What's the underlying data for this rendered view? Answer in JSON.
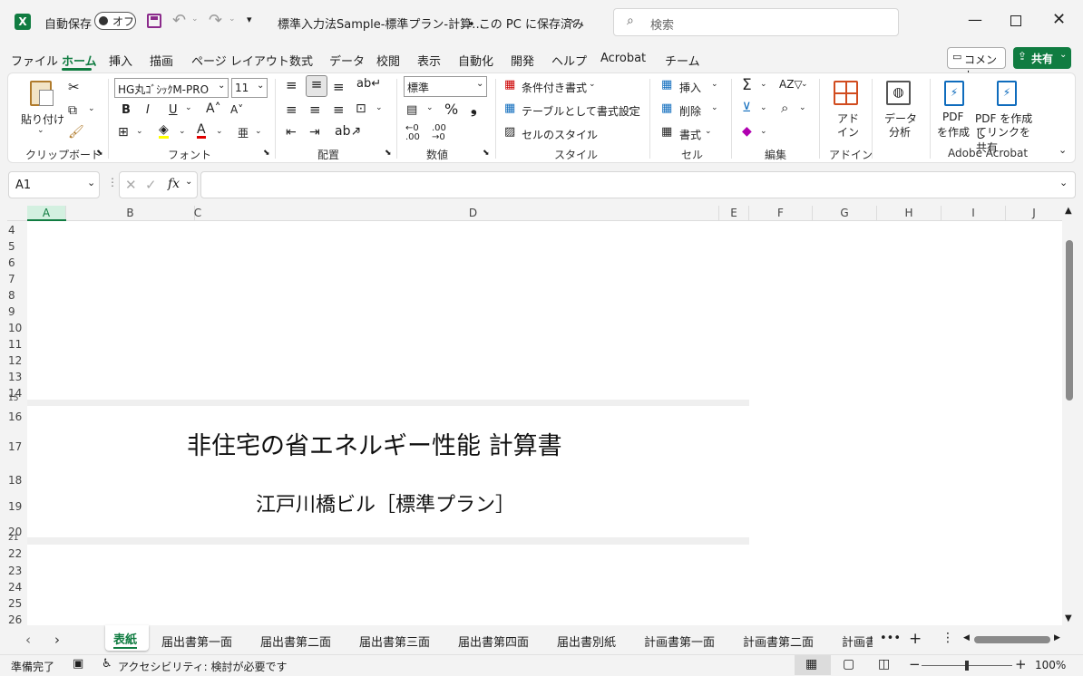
{
  "title_bar": {
    "autosave_label": "自動保存",
    "autosave_state": "オフ",
    "document_title": "標準入力法Sample-標準プラン-計算…",
    "save_status": "• この PC に保存済み",
    "search_placeholder": "検索"
  },
  "menu_tabs": [
    "ファイル",
    "ホーム",
    "挿入",
    "描画",
    "ページ レイアウト",
    "数式",
    "データ",
    "校閲",
    "表示",
    "自動化",
    "開発",
    "ヘルプ",
    "Acrobat",
    "チーム"
  ],
  "active_tab": "ホーム",
  "comment_button": "コメント",
  "share_button": "共有",
  "ribbon": {
    "clipboard": {
      "paste": "貼り付け",
      "group": "クリップボード"
    },
    "font": {
      "name": "HG丸ｺﾞｼｯｸM-PRO",
      "size": "11",
      "bold": "B",
      "italic": "I",
      "underline": "U",
      "group": "フォント"
    },
    "alignment": {
      "group": "配置"
    },
    "number": {
      "format": "標準",
      "percent": "%",
      "group": "数値"
    },
    "styles": {
      "conditional": "条件付き書式",
      "table": "テーブルとして書式設定",
      "cell_styles": "セルのスタイル",
      "group": "スタイル"
    },
    "cells": {
      "insert": "挿入",
      "delete": "削除",
      "format": "書式",
      "group": "セル"
    },
    "editing": {
      "group": "編集"
    },
    "addins": {
      "label1": "アド",
      "label2": "イン",
      "group": "アドイン"
    },
    "analysis": {
      "label1": "データ",
      "label2": "分析"
    },
    "acrobat": {
      "create1": "PDF",
      "create2": "を作成",
      "share1": "PDF を作成し",
      "share2": "てリンクを共有",
      "group": "Adobe Acrobat"
    }
  },
  "formula_bar": {
    "name_box": "A1",
    "formula": ""
  },
  "columns": [
    "A",
    "B",
    "C",
    "D",
    "E",
    "F",
    "G",
    "H",
    "I",
    "J"
  ],
  "rows": [
    "4",
    "5",
    "6",
    "7",
    "8",
    "9",
    "10",
    "11",
    "12",
    "13",
    "14",
    "15",
    "16",
    "17",
    "18",
    "19",
    "20",
    "21",
    "22",
    "23",
    "24",
    "25",
    "26"
  ],
  "cells": {
    "title": "非住宅の省エネルギー性能 計算書",
    "subtitle": "江戸川橋ビル［標準プラン］"
  },
  "sheet_tabs": [
    "表紙",
    "届出書第一面",
    "届出書第二面",
    "届出書第三面",
    "届出書第四面",
    "届出書別紙",
    "計画書第一面",
    "計画書第二面",
    "計画書"
  ],
  "active_sheet": "表紙",
  "status_bar": {
    "ready": "準備完了",
    "accessibility": "アクセシビリティ: 検討が必要です",
    "zoom": "100%"
  },
  "colors": {
    "excel_green": "#107c41",
    "accent": "#0f6cbd"
  }
}
